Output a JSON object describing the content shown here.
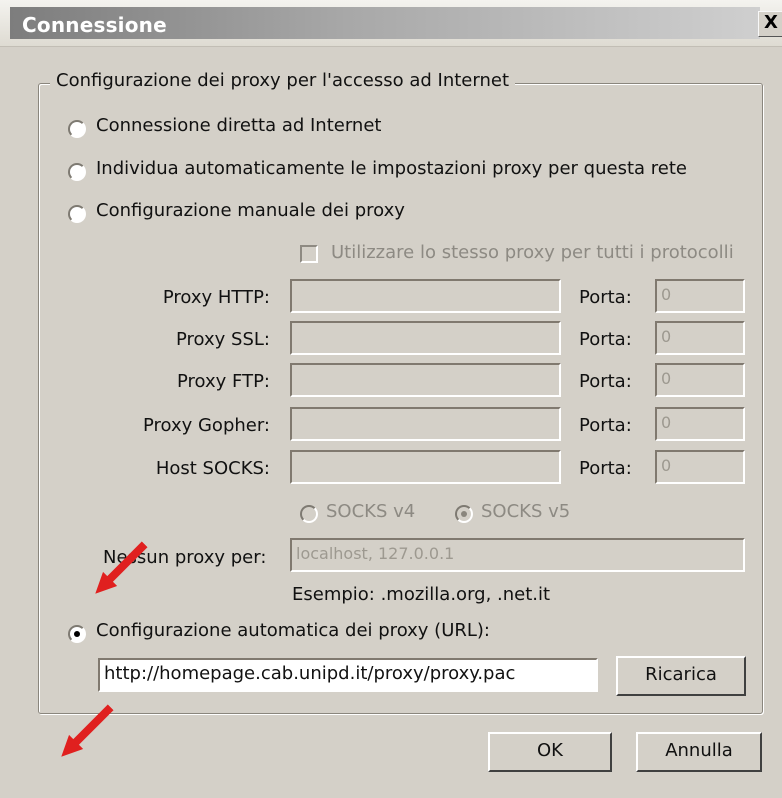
{
  "window": {
    "title": "Connessione",
    "close_glyph": "X"
  },
  "group": {
    "legend": "Configurazione dei proxy per l'accesso ad Internet"
  },
  "options": {
    "direct": "Connessione diretta ad Internet",
    "auto_detect": "Individua automaticamente le impostazioni proxy per questa rete",
    "manual": "Configurazione manuale dei proxy",
    "same_proxy": "Utilizzare lo stesso proxy per tutti i protocolli",
    "auto_config": "Configurazione automatica dei proxy (URL):"
  },
  "manual_config": {
    "fields": [
      {
        "label": "Proxy HTTP:",
        "port_label": "Porta:",
        "port_value": "0",
        "host_value": ""
      },
      {
        "label": "Proxy SSL:",
        "port_label": "Porta:",
        "port_value": "0",
        "host_value": ""
      },
      {
        "label": "Proxy FTP:",
        "port_label": "Porta:",
        "port_value": "0",
        "host_value": ""
      },
      {
        "label": "Proxy Gopher:",
        "port_label": "Porta:",
        "port_value": "0",
        "host_value": ""
      },
      {
        "label": "Host SOCKS:",
        "port_label": "Porta:",
        "port_value": "0",
        "host_value": ""
      }
    ],
    "socks_v4": "SOCKS v4",
    "socks_v5": "SOCKS v5",
    "no_proxy_label": "Nessun proxy per:",
    "no_proxy_value": "localhost, 127.0.0.1",
    "example": "Esempio: .mozilla.org, .net.it"
  },
  "auto_config": {
    "url": "http://homepage.cab.unipd.it/proxy/proxy.pac",
    "reload_button": "Ricarica"
  },
  "buttons": {
    "ok": "OK",
    "cancel": "Annulla"
  },
  "states": {
    "selected_option": "auto_config",
    "same_proxy_checked": false,
    "socks_selected": "v5"
  },
  "colors": {
    "dialog_bg": "#d4d0c8",
    "title_gradient_start": "#7d7d7d",
    "title_gradient_end": "#cfcfcf",
    "annotation_arrow": "#e0201f"
  },
  "icons": {
    "close": "close-icon",
    "annotation_arrow_1": "arrow-icon",
    "annotation_arrow_2": "arrow-icon"
  }
}
